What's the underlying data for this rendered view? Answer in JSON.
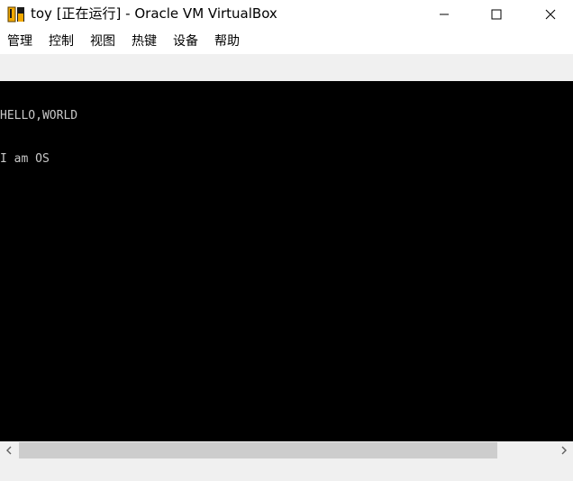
{
  "window": {
    "title": "toy [正在运行] - Oracle VM VirtualBox",
    "app_icon": "virtualbox-icon"
  },
  "controls": {
    "minimize_icon": "minimize-icon",
    "maximize_icon": "maximize-icon",
    "close_icon": "close-icon"
  },
  "menu": {
    "items": [
      {
        "label": "管理"
      },
      {
        "label": "控制"
      },
      {
        "label": "视图"
      },
      {
        "label": "热键"
      },
      {
        "label": "设备"
      },
      {
        "label": "帮助"
      }
    ]
  },
  "console": {
    "lines": [
      "HELLO,WORLD",
      "I am OS"
    ]
  },
  "scrollbar": {
    "left_icon": "chevron-left-icon",
    "right_icon": "chevron-right-icon",
    "thumb_fraction": 0.86
  },
  "colors": {
    "screen_bg": "#000000",
    "console_text": "#c8c8c8",
    "chrome_bg": "#f0f0f0",
    "scroll_thumb": "#cdcdcd"
  }
}
